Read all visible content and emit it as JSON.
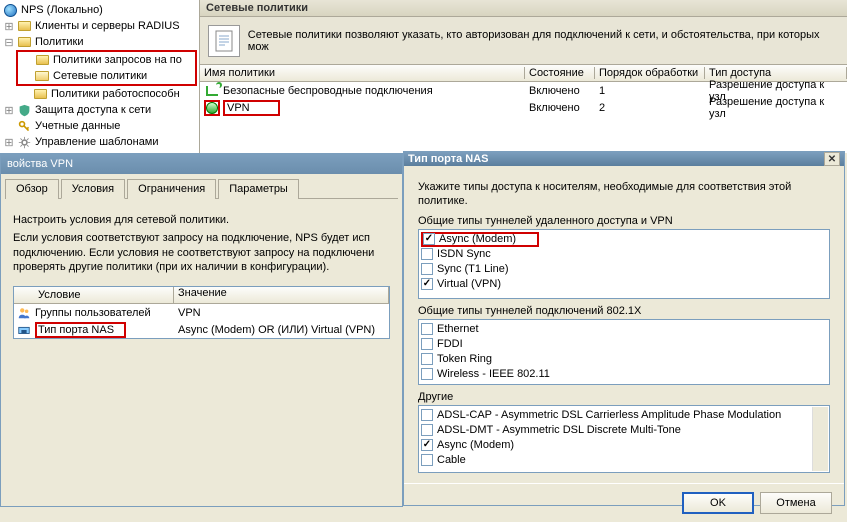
{
  "tree": {
    "root": "NPS (Локально)",
    "items": {
      "clients": "Клиенты и серверы RADIUS",
      "policies": "Политики",
      "req_policies": "Политики запросов на по",
      "net_policies": "Сетевые политики",
      "health_policies": "Политики работоспособн",
      "nap": "Защита доступа к сети",
      "accounting": "Учетные данные",
      "templates": "Управление шаблонами"
    }
  },
  "content": {
    "header": "Сетевые политики",
    "info": "Сетевые политики позволяют указать, кто авторизован для подключений к сети, и обстоятельства, при которых мож",
    "columns": {
      "name": "Имя политики",
      "state": "Состояние",
      "order": "Порядок обработки",
      "type": "Тип доступа"
    },
    "rows": [
      {
        "name": "Безопасные беспроводные подключения",
        "state": "Включено",
        "order": "1",
        "type": "Разрешение доступа к узл"
      },
      {
        "name": "VPN",
        "state": "Включено",
        "order": "2",
        "type": "Разрешение доступа к узл"
      }
    ]
  },
  "props": {
    "title": "войства VPN",
    "tabs": {
      "overview": "Обзор",
      "conditions": "Условия",
      "limits": "Ограничения",
      "params": "Параметры"
    },
    "intro": "Настроить условия для сетевой политики.",
    "desc": "Если условия соответствуют запросу на подключение, NPS будет исп\nподключению. Если условия не соответствуют запросу на подключени\nпроверять другие политики (при их наличии в конфигурации).",
    "cols": {
      "cond": "Условие",
      "val": "Значение"
    },
    "rows": [
      {
        "cond": "Группы пользователей",
        "val": "VPN"
      },
      {
        "cond": "Тип порта NAS",
        "val": "Async (Modem) OR (ИЛИ) Virtual (VPN)"
      }
    ]
  },
  "dialog": {
    "title": "Тип порта NAS",
    "intro": "Укажите типы доступа к носителям, необходимые для соответствия этой политике.",
    "group_common": "Общие типы туннелей удаленного доступа и VPN",
    "common": [
      {
        "label": "Async (Modem)",
        "checked": true
      },
      {
        "label": "ISDN Sync",
        "checked": false
      },
      {
        "label": "Sync (T1 Line)",
        "checked": false
      },
      {
        "label": "Virtual (VPN)",
        "checked": true
      }
    ],
    "group_8021x": "Общие типы туннелей подключений 802.1X",
    "x8021x": [
      {
        "label": "Ethernet",
        "checked": false
      },
      {
        "label": "FDDI",
        "checked": false
      },
      {
        "label": "Token Ring",
        "checked": false
      },
      {
        "label": "Wireless - IEEE 802.11",
        "checked": false
      }
    ],
    "group_other": "Другие",
    "other": [
      {
        "label": "ADSL-CAP - Asymmetric DSL Carrierless Amplitude Phase Modulation",
        "checked": false
      },
      {
        "label": "ADSL-DMT - Asymmetric DSL Discrete Multi-Tone",
        "checked": false
      },
      {
        "label": "Async (Modem)",
        "checked": true
      },
      {
        "label": "Cable",
        "checked": false
      }
    ],
    "ok": "OK",
    "cancel": "Отмена"
  },
  "colors": {
    "highlight": "#d00000"
  }
}
